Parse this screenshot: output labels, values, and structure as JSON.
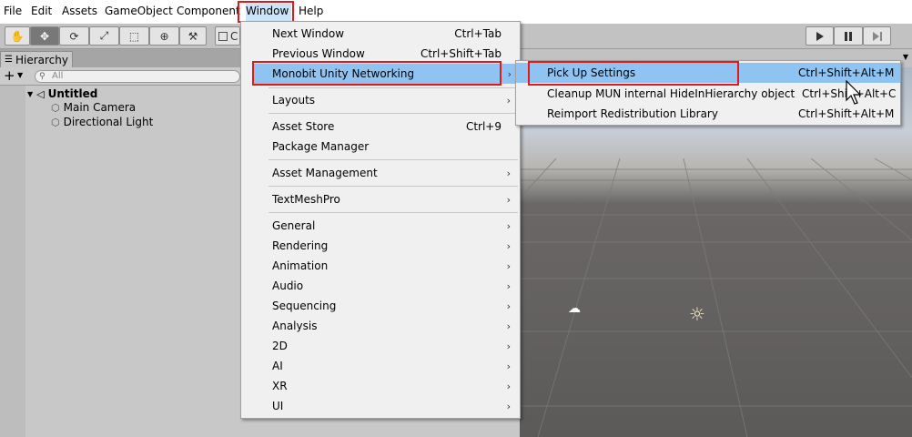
{
  "menubar": {
    "items": [
      "File",
      "Edit",
      "Assets",
      "GameObject",
      "Component",
      "Window",
      "Help"
    ]
  },
  "toolbar": {
    "pivot_label": "C"
  },
  "hierarchy": {
    "tab_label": "Hierarchy",
    "add_label": "+",
    "search_placeholder": "All",
    "scene_name": "Untitled",
    "objects": [
      "Main Camera",
      "Directional Light"
    ]
  },
  "window_menu": {
    "items": [
      {
        "label": "Next Window",
        "shortcut": "Ctrl+Tab"
      },
      {
        "label": "Previous Window",
        "shortcut": "Ctrl+Shift+Tab"
      },
      {
        "label": "Monobit Unity Networking",
        "shortcut": ""
      },
      {
        "label": "Layouts",
        "shortcut": ""
      },
      {
        "label": "Asset Store",
        "shortcut": "Ctrl+9"
      },
      {
        "label": "Package Manager",
        "shortcut": ""
      },
      {
        "label": "Asset Management",
        "shortcut": ""
      },
      {
        "label": "TextMeshPro",
        "shortcut": ""
      },
      {
        "label": "General",
        "shortcut": ""
      },
      {
        "label": "Rendering",
        "shortcut": ""
      },
      {
        "label": "Animation",
        "shortcut": ""
      },
      {
        "label": "Audio",
        "shortcut": ""
      },
      {
        "label": "Sequencing",
        "shortcut": ""
      },
      {
        "label": "Analysis",
        "shortcut": ""
      },
      {
        "label": "2D",
        "shortcut": ""
      },
      {
        "label": "AI",
        "shortcut": ""
      },
      {
        "label": "XR",
        "shortcut": ""
      },
      {
        "label": "UI",
        "shortcut": ""
      }
    ]
  },
  "submenu": {
    "items": [
      {
        "label": "Pick Up Settings",
        "shortcut": "Ctrl+Shift+Alt+M"
      },
      {
        "label": "Cleanup MUN internal HideInHierarchy object",
        "shortcut": "Ctrl+Shift+Alt+C"
      },
      {
        "label": "Reimport Redistribution Library",
        "shortcut": "Ctrl+Shift+Alt+M"
      }
    ]
  },
  "colors": {
    "highlight_box": "#e01919",
    "menu_hover": "#8ec3f2"
  }
}
